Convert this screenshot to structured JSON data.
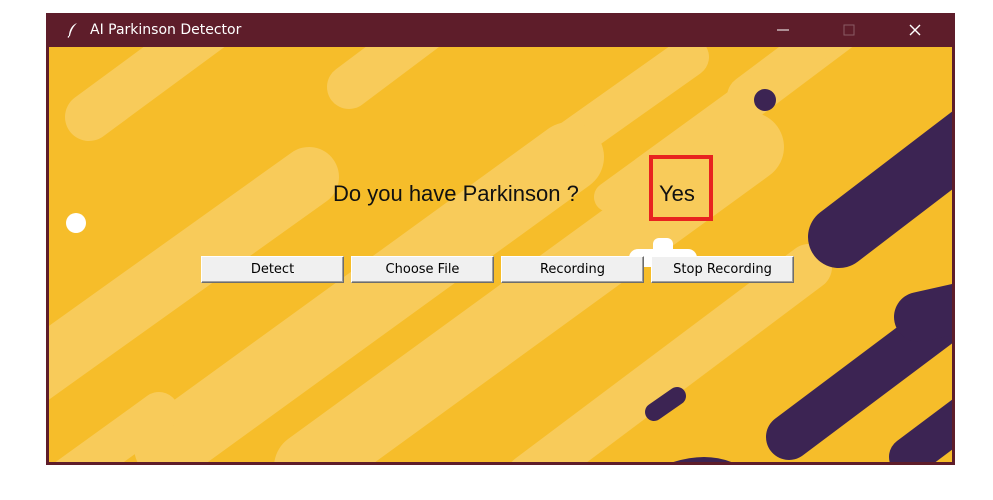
{
  "window": {
    "title": "AI Parkinson Detector",
    "icon": "feather-icon"
  },
  "main": {
    "question": "Do you have Parkinson ?",
    "answer": "Yes"
  },
  "buttons": {
    "detect": "Detect",
    "choose_file": "Choose File",
    "recording": "Recording",
    "stop_recording": "Stop Recording"
  },
  "colors": {
    "titlebar": "#5e1d2a",
    "background": "#f6bd2a",
    "light_stripe": "#f8cb5a",
    "dark_stripe": "#3c2453",
    "highlight_border": "#e8231f"
  }
}
